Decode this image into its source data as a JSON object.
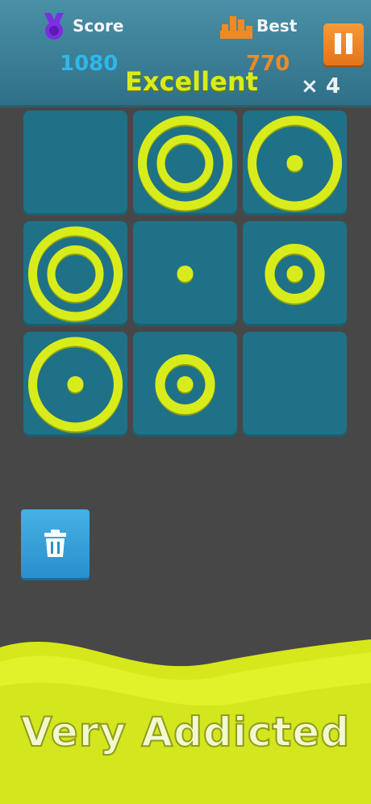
{
  "header": {
    "score_label": "Score",
    "score_value": "1080",
    "best_label": "Best",
    "best_value": "770",
    "rank_text": "Excellent",
    "multiplier": "× 4"
  },
  "board": {
    "rows": 3,
    "cols": 3,
    "cells": [
      {
        "pieces": []
      },
      {
        "pieces": [
          "ring-large",
          "ring-medium"
        ]
      },
      {
        "pieces": [
          "ring-large",
          "dot"
        ]
      },
      {
        "pieces": [
          "ring-large",
          "ring-medium"
        ]
      },
      {
        "pieces": [
          "dot"
        ]
      },
      {
        "pieces": [
          "ring-small",
          "dot"
        ]
      },
      {
        "pieces": [
          "ring-large",
          "dot"
        ]
      },
      {
        "pieces": [
          "ring-small",
          "dot"
        ]
      },
      {
        "pieces": []
      }
    ]
  },
  "controls": {
    "pause_icon": "pause-icon",
    "trash_icon": "trash-icon"
  },
  "banner": {
    "text": "Very Addicted"
  },
  "colors": {
    "ring": "#d9ec1b",
    "cell": "#1f7187",
    "header": "#3b819a",
    "score": "#2fb7ea",
    "best": "#f08a24"
  }
}
